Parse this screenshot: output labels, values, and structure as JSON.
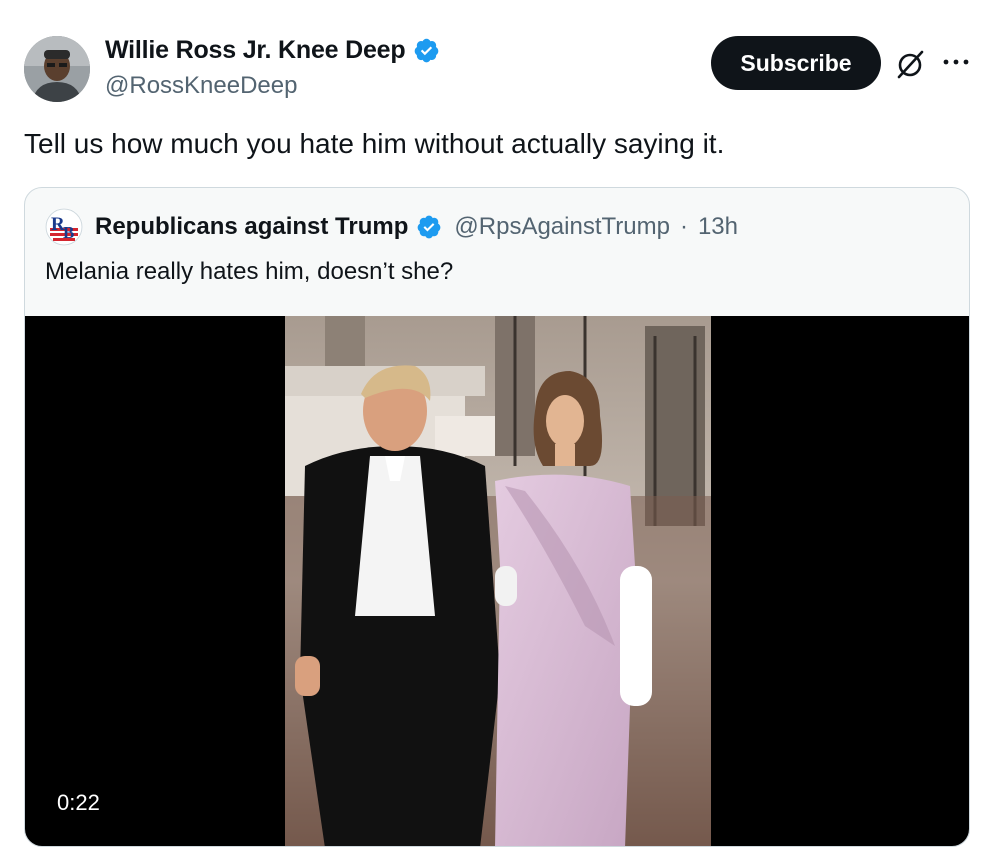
{
  "post": {
    "author_name": "Willie Ross Jr. Knee Deep",
    "author_handle": "@RossKneeDeep",
    "subscribe_label": "Subscribe",
    "text": "Tell us how much you hate him without actually saying it."
  },
  "quoted_post": {
    "author_name": "Republicans against Trump",
    "author_handle": "@RpsAgainstTrump",
    "separator": "·",
    "time": "13h",
    "text": "Melania really hates him, doesn’t she?",
    "video_duration": "0:22"
  },
  "colors": {
    "verified_blue": "#1d9bf0",
    "subscribe_bg": "#0f1419",
    "secondary_text": "#536471",
    "border": "#cfd9de"
  },
  "icons": [
    "verified-badge-icon",
    "grok-icon",
    "more-options-icon"
  ]
}
